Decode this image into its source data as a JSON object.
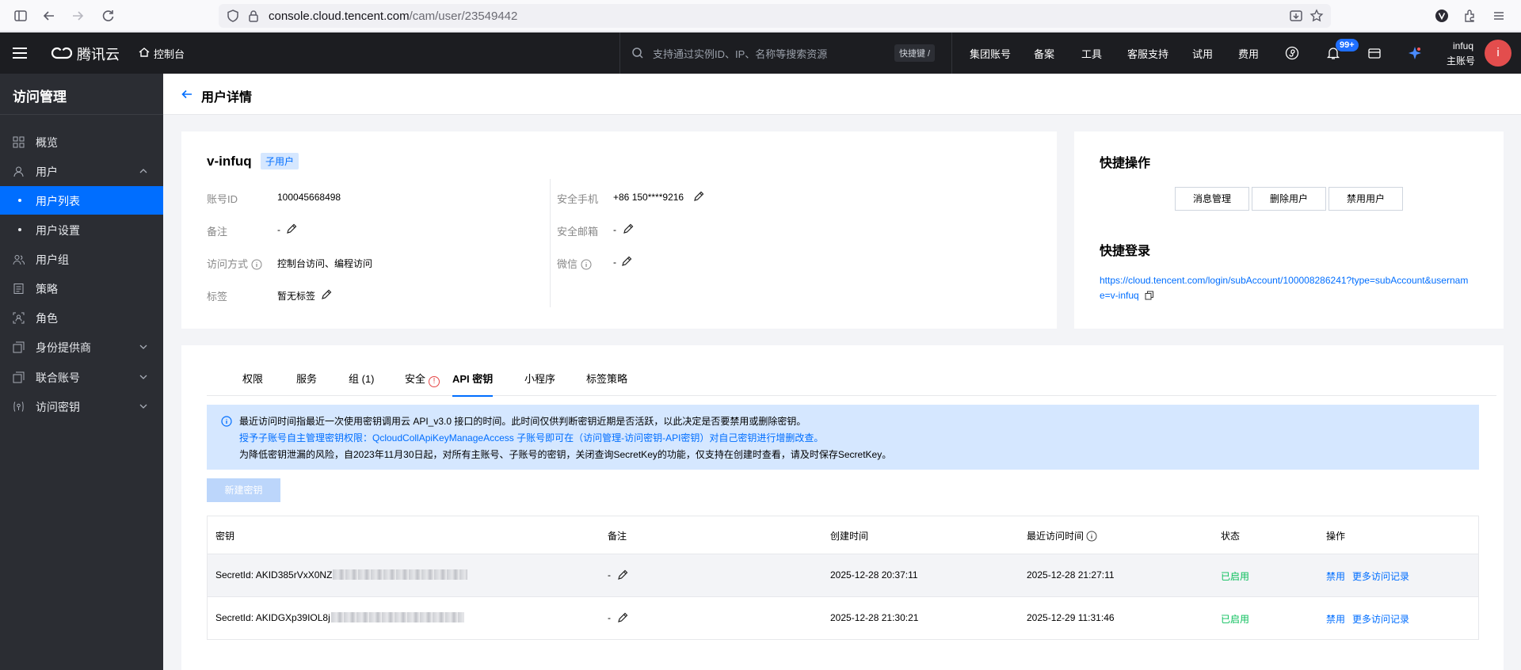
{
  "browser": {
    "url_host": "console.cloud.tencent.com",
    "url_path": "/cam/user/23549442"
  },
  "topnav": {
    "brand": "腾讯云",
    "console": "控制台",
    "search_placeholder": "支持通过实例ID、IP、名称等搜索资源",
    "shortcut": "快捷键 /",
    "items": [
      "集团账号",
      "备案",
      "工具",
      "客服支持",
      "试用",
      "费用"
    ],
    "notification_count": "99+",
    "user_name": "infuq",
    "user_role": "主账号",
    "avatar_letter": "i"
  },
  "sidebar": {
    "title": "访问管理",
    "items": [
      {
        "label": "概览",
        "icon": "grid-icon"
      },
      {
        "label": "用户",
        "icon": "user-icon"
      },
      {
        "label": "用户列表"
      },
      {
        "label": "用户设置"
      },
      {
        "label": "用户组",
        "icon": "user-group-icon"
      },
      {
        "label": "策略",
        "icon": "policy-icon"
      },
      {
        "label": "角色",
        "icon": "role-icon"
      },
      {
        "label": "身份提供商",
        "icon": "idp-icon"
      },
      {
        "label": "联合账号",
        "icon": "federated-icon"
      },
      {
        "label": "访问密钥",
        "icon": "key-icon"
      }
    ]
  },
  "page": {
    "title": "用户详情"
  },
  "user": {
    "name": "v-infuq",
    "type_tag": "子用户",
    "fields": {
      "account_id_label": "账号ID",
      "account_id": "100045668498",
      "remark_label": "备注",
      "remark": "-",
      "access_label": "访问方式",
      "access": "控制台访问、编程访问",
      "tags_label": "标签",
      "tags": "暂无标签",
      "phone_label": "安全手机",
      "phone": "+86 150****9216",
      "email_label": "安全邮箱",
      "email": "-",
      "wechat_label": "微信",
      "wechat": "-"
    }
  },
  "quick": {
    "ops_title": "快捷操作",
    "buttons": [
      "消息管理",
      "删除用户",
      "禁用用户"
    ],
    "login_title": "快捷登录",
    "login_link": "https://cloud.tencent.com/login/subAccount/100008286241?type=subAccount&username=v-infuq"
  },
  "tabs": [
    "权限",
    "服务",
    "组 (1)",
    "安全",
    "API 密钥",
    "小程序",
    "标签策略"
  ],
  "notice": {
    "line1": "最近访问时间指最近一次使用密钥调用云 API_v3.0 接口的时间。此时间仅供判断密钥近期是否活跃，以此决定是否要禁用或删除密钥。",
    "line2": "授予子账号自主管理密钥权限：QcloudCollApiKeyManageAccess 子账号即可在（访问管理-访问密钥-API密钥）对自己密钥进行增删改查。",
    "line3": "为降低密钥泄漏的风险，自2023年11月30日起，对所有主账号、子账号的密钥，关闭查询SecretKey的功能，仅支持在创建时查看，请及时保存SecretKey。"
  },
  "new_key_button": "新建密钥",
  "table": {
    "headers": [
      "密钥",
      "备注",
      "创建时间",
      "最近访问时间",
      "状态",
      "操作"
    ],
    "rows": [
      {
        "secret": "SecretId: AKID385rVxX0NZ",
        "remark": "-",
        "created": "2025-12-28 20:37:11",
        "last_access": "2025-12-28 21:27:11",
        "status": "已启用",
        "op1": "禁用",
        "op2": "更多访问记录"
      },
      {
        "secret": "SecretId: AKIDGXp39IOL8j",
        "remark": "-",
        "created": "2025-12-28 21:30:21",
        "last_access": "2025-12-29 11:31:46",
        "status": "已启用",
        "op1": "禁用",
        "op2": "更多访问记录"
      }
    ]
  }
}
